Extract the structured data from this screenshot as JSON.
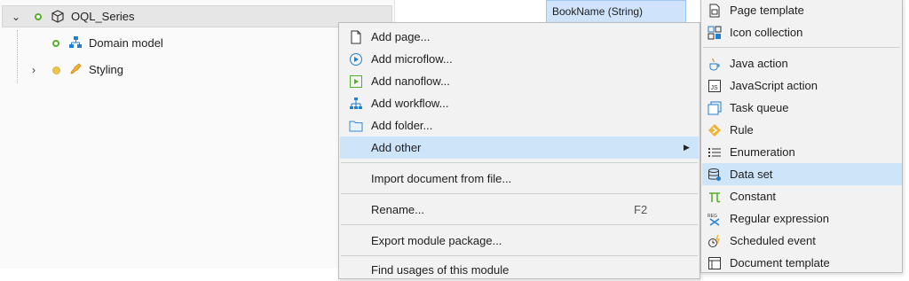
{
  "tree": {
    "items": [
      {
        "label": "OQL_Series",
        "icon": "module-icon",
        "expander": "expanded"
      },
      {
        "label": "Domain model",
        "icon": "domain-model-icon"
      },
      {
        "label": "Styling",
        "icon": "styling-icon",
        "expander": "collapsed"
      }
    ]
  },
  "background": {
    "column_header": "BookName (String)"
  },
  "context_menu": {
    "items": [
      {
        "label": "Add page...",
        "icon": "page-icon"
      },
      {
        "label": "Add microflow...",
        "icon": "microflow-icon"
      },
      {
        "label": "Add nanoflow...",
        "icon": "nanoflow-icon"
      },
      {
        "label": "Add workflow...",
        "icon": "workflow-icon"
      },
      {
        "label": "Add folder...",
        "icon": "folder-icon"
      },
      {
        "label": "Add other",
        "submenu": true,
        "highlighted": true
      },
      {
        "label": "Import document from file..."
      },
      {
        "label": "Rename...",
        "shortcut": "F2"
      },
      {
        "label": "Export module package..."
      },
      {
        "label": "Find usages of this module"
      }
    ]
  },
  "submenu": {
    "items": [
      {
        "label": "Page template",
        "icon": "page-template-icon"
      },
      {
        "label": "Icon collection",
        "icon": "icon-collection-icon"
      },
      {
        "label": "Java action",
        "icon": "java-action-icon"
      },
      {
        "label": "JavaScript action",
        "icon": "javascript-action-icon"
      },
      {
        "label": "Task queue",
        "icon": "task-queue-icon"
      },
      {
        "label": "Rule",
        "icon": "rule-icon"
      },
      {
        "label": "Enumeration",
        "icon": "enumeration-icon"
      },
      {
        "label": "Data set",
        "icon": "data-set-icon",
        "highlighted": true
      },
      {
        "label": "Constant",
        "icon": "constant-icon"
      },
      {
        "label": "Regular expression",
        "icon": "regular-expression-icon"
      },
      {
        "label": "Scheduled event",
        "icon": "scheduled-event-icon"
      },
      {
        "label": "Document template",
        "icon": "document-template-icon"
      }
    ]
  },
  "colors": {
    "highlight": "#cde4f9",
    "menu_bg": "#f2f2f2",
    "accent_green": "#5aae2e",
    "accent_blue": "#1f7fd1"
  }
}
